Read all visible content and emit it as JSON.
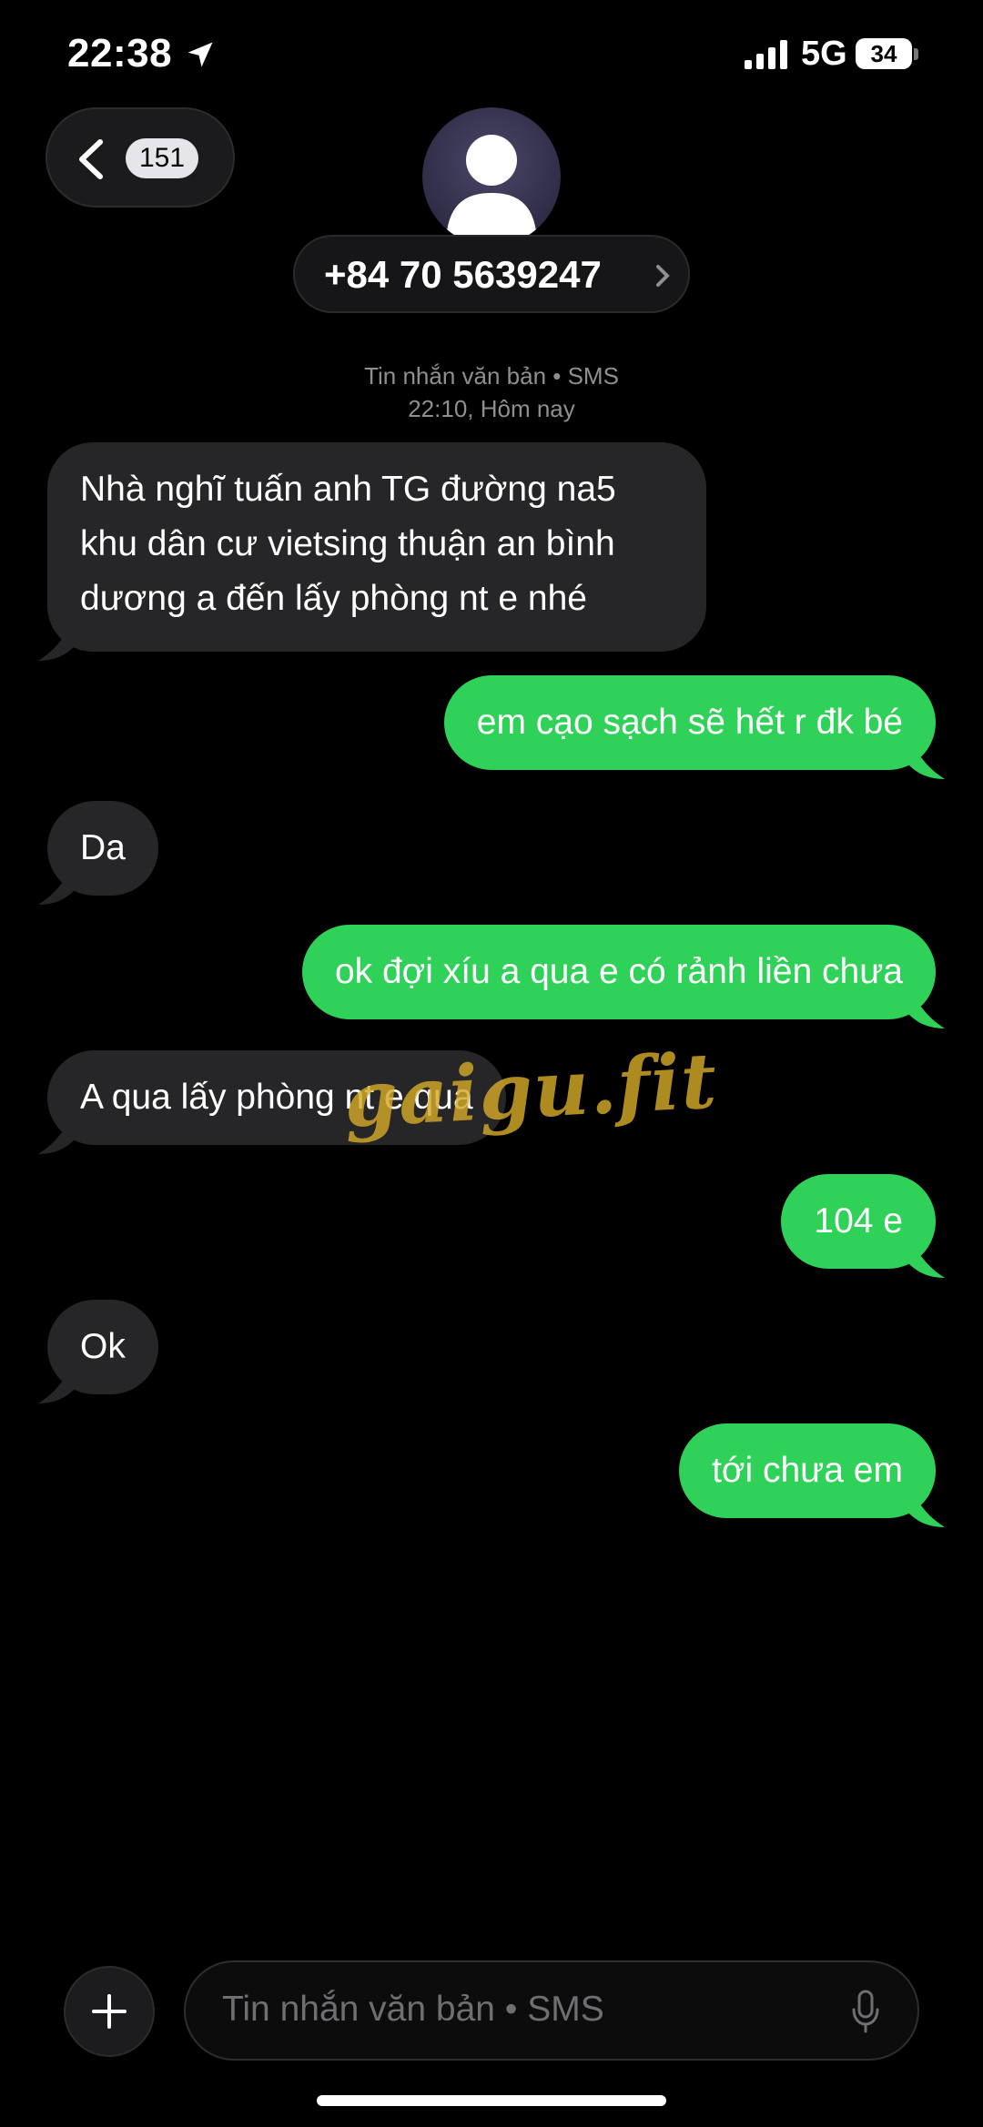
{
  "status_bar": {
    "time": "22:38",
    "network": "5G",
    "battery": "34",
    "icons": [
      "location-arrow-icon",
      "signal-bars-icon",
      "battery-icon"
    ]
  },
  "nav": {
    "unread_count": "151",
    "contact_number": "+84 70 5639247"
  },
  "thread_meta": {
    "type_line": "Tin nhắn văn bản • SMS",
    "time_line": "22:10, Hôm nay"
  },
  "messages": [
    {
      "direction": "incoming",
      "lines": [
        "Nhà nghĩ tuấn anh TG đường na5",
        "khu dân cư vietsing thuận an bình",
        "dương a đến lấy phòng nt e nhé"
      ]
    },
    {
      "direction": "outgoing",
      "lines": [
        "em cạo sạch sẽ hết r đk bé"
      ]
    },
    {
      "direction": "incoming",
      "lines": [
        "Da"
      ]
    },
    {
      "direction": "outgoing",
      "lines": [
        "ok đợi xíu a qua e có rảnh liền chưa"
      ]
    },
    {
      "direction": "incoming",
      "lines": [
        "A qua lấy phòng nt e qua"
      ]
    },
    {
      "direction": "outgoing",
      "lines": [
        "104 e"
      ]
    },
    {
      "direction": "incoming",
      "lines": [
        "Ok"
      ]
    },
    {
      "direction": "outgoing",
      "lines": [
        "tới chưa em"
      ]
    }
  ],
  "watermark": "gaigu.fit",
  "composer": {
    "placeholder": "Tin nhắn văn bản • SMS"
  },
  "colors": {
    "background": "#000000",
    "incoming_bubble": "#262628",
    "outgoing_bubble": "#30d158",
    "meta_text": "#8e8e93",
    "watermark": "#d4aa28"
  }
}
